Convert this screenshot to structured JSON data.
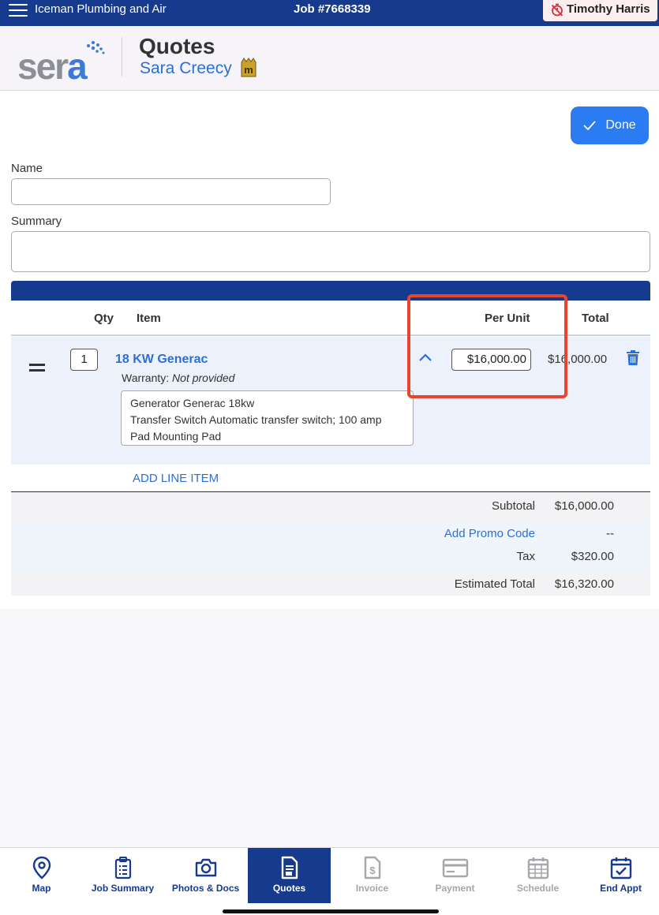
{
  "topbar": {
    "company": "Iceman Plumbing and Air",
    "job_number": "Job #7668339",
    "user": "Timothy Harris"
  },
  "header": {
    "logo_text": "sera",
    "title": "Quotes",
    "customer": "Sara Creecy",
    "member_badge": "m"
  },
  "form": {
    "done_label": "Done",
    "name_label": "Name",
    "name_value": "",
    "summary_label": "Summary",
    "summary_value": ""
  },
  "table": {
    "columns": {
      "qty": "Qty",
      "item": "Item",
      "per_unit": "Per Unit",
      "total": "Total"
    },
    "items": [
      {
        "qty": "1",
        "name": "18 KW Generac",
        "warranty_label": "Warranty:",
        "warranty_value": "Not provided",
        "description": [
          "Generator Generac 18kw",
          "Transfer Switch Automatic transfer switch; 100 amp",
          "Pad Mounting Pad"
        ],
        "per_unit": "$16,000.00",
        "total": "$16,000.00"
      }
    ],
    "add_line_label": "ADD LINE ITEM"
  },
  "summary": {
    "subtotal_label": "Subtotal",
    "subtotal_value": "$16,000.00",
    "promo_label": "Add Promo Code",
    "promo_value": "--",
    "tax_label": "Tax",
    "tax_value": "$320.00",
    "estimated_label": "Estimated Total",
    "estimated_value": "$16,320.00"
  },
  "nav": {
    "items": [
      {
        "label": "Map",
        "icon": "map-pin-icon"
      },
      {
        "label": "Job Summary",
        "icon": "clipboard-icon"
      },
      {
        "label": "Photos & Docs",
        "icon": "camera-icon"
      },
      {
        "label": "Quotes",
        "icon": "document-icon"
      },
      {
        "label": "Invoice",
        "icon": "invoice-icon"
      },
      {
        "label": "Payment",
        "icon": "card-icon"
      },
      {
        "label": "Schedule",
        "icon": "calendar-icon"
      },
      {
        "label": "End Appt",
        "icon": "calendar-check-icon"
      }
    ],
    "active": "Quotes"
  },
  "colors": {
    "primary": "#163a8e",
    "accent": "#2b7bf3",
    "link": "#2a70d6",
    "highlight": "#e8462c"
  }
}
